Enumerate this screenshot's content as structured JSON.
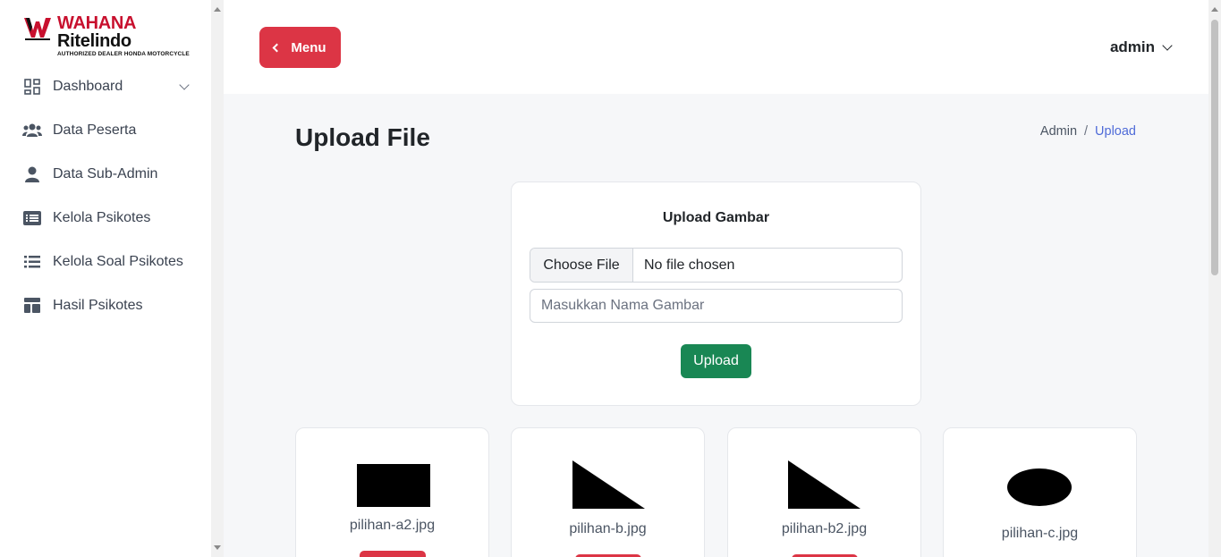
{
  "brand": {
    "name_part1": "WAHANA",
    "name_part2": "Ritelindo",
    "tagline": "AUTHORIZED DEALER HONDA MOTORCYCLE",
    "accent": "#c8102e"
  },
  "sidebar": {
    "items": [
      {
        "label": "Dashboard",
        "icon": "dashboard-icon",
        "has_submenu": true
      },
      {
        "label": "Data Peserta",
        "icon": "users-icon"
      },
      {
        "label": "Data Sub-Admin",
        "icon": "user-icon"
      },
      {
        "label": "Kelola Psikotes",
        "icon": "list-card-icon"
      },
      {
        "label": "Kelola Soal Psikotes",
        "icon": "list-icon"
      },
      {
        "label": "Hasil Psikotes",
        "icon": "layout-icon"
      }
    ]
  },
  "header": {
    "menu_label": "Menu",
    "user_label": "admin"
  },
  "page": {
    "title": "Upload File",
    "breadcrumb": [
      "Admin",
      "Upload"
    ]
  },
  "upload_form": {
    "title": "Upload Gambar",
    "choose_file_label": "Choose File",
    "no_file_label": "No file chosen",
    "name_placeholder": "Masukkan Nama Gambar",
    "submit_label": "Upload"
  },
  "images": [
    {
      "filename": "pilihan-a2.jpg",
      "shape": "rectangle"
    },
    {
      "filename": "pilihan-b.jpg",
      "shape": "triangle"
    },
    {
      "filename": "pilihan-b2.jpg",
      "shape": "triangle"
    },
    {
      "filename": "pilihan-c.jpg",
      "shape": "ellipse"
    }
  ],
  "colors": {
    "danger": "#dc3545",
    "success": "#198754",
    "link": "#4f6bd8"
  }
}
